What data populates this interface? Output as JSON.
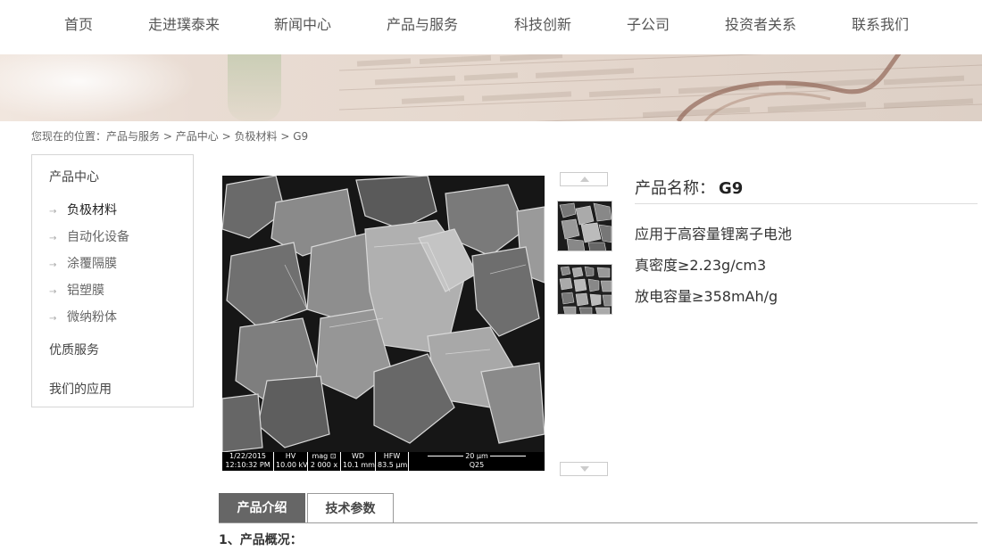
{
  "nav": {
    "items": [
      {
        "label": "首页"
      },
      {
        "label": "走进璞泰来"
      },
      {
        "label": "新闻中心"
      },
      {
        "label": "产品与服务"
      },
      {
        "label": "科技创新"
      },
      {
        "label": "子公司"
      },
      {
        "label": "投资者关系"
      },
      {
        "label": "联系我们"
      }
    ]
  },
  "breadcrumb": {
    "prefix": "您现在的位置：",
    "items": [
      "产品与服务",
      "产品中心",
      "负极材料",
      "G9"
    ],
    "separator": ">"
  },
  "sidebar": {
    "title": "产品中心",
    "subitems": [
      {
        "label": "负极材料",
        "active": true
      },
      {
        "label": "自动化设备",
        "active": false
      },
      {
        "label": "涂覆隔膜",
        "active": false
      },
      {
        "label": "铝塑膜",
        "active": false
      },
      {
        "label": "微纳粉体",
        "active": false
      }
    ],
    "service": "优质服务",
    "applications": "我们的应用"
  },
  "image": {
    "databar": {
      "date": "1/22/2015",
      "time": "12:10:32 PM",
      "hv_label": "HV",
      "hv_value": "10.00 kV",
      "mag_label": "mag ⊡",
      "mag_value": "2 000 x",
      "wd_label": "WD",
      "wd_value": "10.1 mm",
      "hfw_label": "HFW",
      "hfw_value": "83.5 μm",
      "scale_label": "20 μm",
      "sample": "Q25"
    }
  },
  "product": {
    "name_label": "产品名称：",
    "name_value": "G9",
    "desc": [
      "应用于高容量锂离子电池",
      "真密度≥2.23g/cm3",
      "放电容量≥358mAh/g"
    ]
  },
  "tabs": [
    {
      "label": "产品介绍",
      "active": true
    },
    {
      "label": "技术参数",
      "active": false
    }
  ],
  "section": {
    "title": "1、产品概况："
  },
  "colors": {
    "tab_active_bg": "#666666",
    "nav_text": "#555555"
  }
}
